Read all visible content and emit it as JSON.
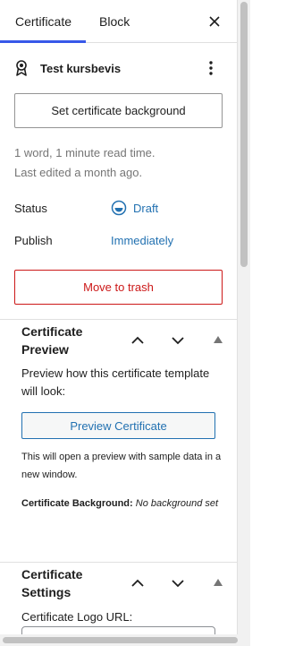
{
  "tabs": {
    "certificate": "Certificate",
    "block": "Block"
  },
  "post": {
    "icon": "award-ribbon-icon",
    "title": "Test kursbevis"
  },
  "actions": {
    "set_background": "Set certificate background",
    "trash": "Move to trash"
  },
  "meta": {
    "word_count": "1 word, 1 minute read time.",
    "last_edited": "Last edited a month ago."
  },
  "status": {
    "label": "Status",
    "value": "Draft",
    "icon": "draft-circle-icon"
  },
  "publish": {
    "label": "Publish",
    "value": "Immediately"
  },
  "preview_section": {
    "title": "Certificate Preview",
    "description": "Preview how this certificate template will look:",
    "button": "Preview Certificate",
    "note": "This will open a preview with sample data in a new window.",
    "background_label": "Certificate Background:",
    "background_value": "No background set"
  },
  "settings_section": {
    "title": "Certificate Settings",
    "logo_url_label": "Certificate Logo URL:",
    "logo_url_value": ""
  },
  "colors": {
    "accent": "#3858e9",
    "link": "#2271b1",
    "danger": "#cc1818"
  }
}
